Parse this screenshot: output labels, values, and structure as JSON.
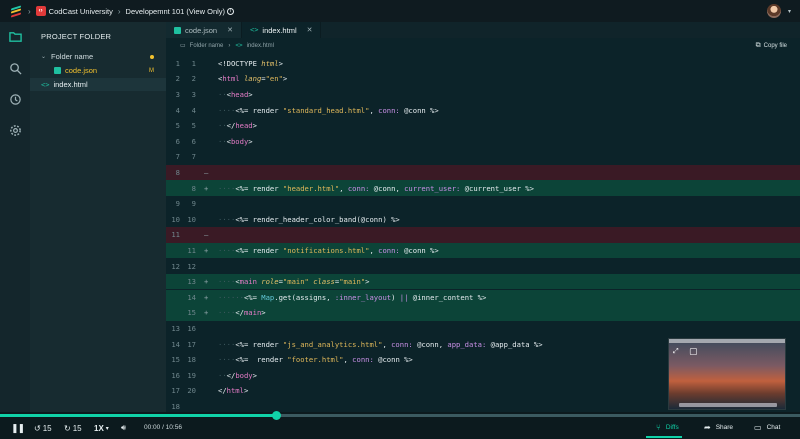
{
  "topbar": {
    "org": "CodCast University",
    "course": "Developemnt 101 (View Only)",
    "logo_colors": [
      "#21c7a8",
      "#f2c12e",
      "#e13a3a"
    ]
  },
  "rail": {
    "icons": [
      "folder-icon",
      "search-icon",
      "history-icon",
      "settings-icon"
    ]
  },
  "panel": {
    "title": "PROJECT FOLDER",
    "folder": "Folder name",
    "files": [
      {
        "name": "code.json",
        "status": "M"
      },
      {
        "name": "index.html",
        "status": ""
      }
    ]
  },
  "tabs": [
    {
      "label": "code.json"
    },
    {
      "label": "index.html"
    }
  ],
  "breadcrumb": {
    "folder": "Folder name",
    "file": "index.html",
    "copy_label": "Copy file"
  },
  "editor": {
    "lines": [
      {
        "l": "1",
        "r": "1",
        "m": "",
        "type": "normal"
      },
      {
        "l": "2",
        "r": "2",
        "m": "",
        "type": "normal"
      },
      {
        "l": "3",
        "r": "3",
        "m": "",
        "type": "normal"
      },
      {
        "l": "4",
        "r": "4",
        "m": "",
        "type": "normal"
      },
      {
        "l": "5",
        "r": "5",
        "m": "",
        "type": "normal"
      },
      {
        "l": "6",
        "r": "6",
        "m": "",
        "type": "normal"
      },
      {
        "l": "7",
        "r": "7",
        "m": "",
        "type": "normal"
      },
      {
        "l": "8",
        "r": "",
        "m": "–",
        "type": "removed"
      },
      {
        "l": "",
        "r": "8",
        "m": "+",
        "type": "added"
      },
      {
        "l": "9",
        "r": "9",
        "m": "",
        "type": "normal"
      },
      {
        "l": "10",
        "r": "10",
        "m": "",
        "type": "normal"
      },
      {
        "l": "11",
        "r": "",
        "m": "–",
        "type": "removed"
      },
      {
        "l": "",
        "r": "11",
        "m": "+",
        "type": "added"
      },
      {
        "l": "12",
        "r": "12",
        "m": "",
        "type": "normal"
      },
      {
        "l": "",
        "r": "13",
        "m": "+",
        "type": "added"
      },
      {
        "l": "",
        "r": "14",
        "m": "+",
        "type": "added"
      },
      {
        "l": "",
        "r": "15",
        "m": "+",
        "type": "added"
      },
      {
        "l": "13",
        "r": "16",
        "m": "",
        "type": "normal"
      },
      {
        "l": "14",
        "r": "17",
        "m": "",
        "type": "normal"
      },
      {
        "l": "15",
        "r": "18",
        "m": "",
        "type": "normal"
      },
      {
        "l": "16",
        "r": "19",
        "m": "",
        "type": "normal"
      },
      {
        "l": "17",
        "r": "20",
        "m": "",
        "type": "normal"
      },
      {
        "l": "18",
        "r": "",
        "m": "",
        "type": "normal"
      }
    ]
  },
  "player": {
    "play_icon": "pause-icon",
    "back_label": "15",
    "forward_label": "15",
    "speed": "1X",
    "time": "00:00 / 10:56",
    "progress": 0.345,
    "diffs": "Diffs",
    "share": "Share",
    "chat": "Chat",
    "accent": "#10d2a8"
  }
}
